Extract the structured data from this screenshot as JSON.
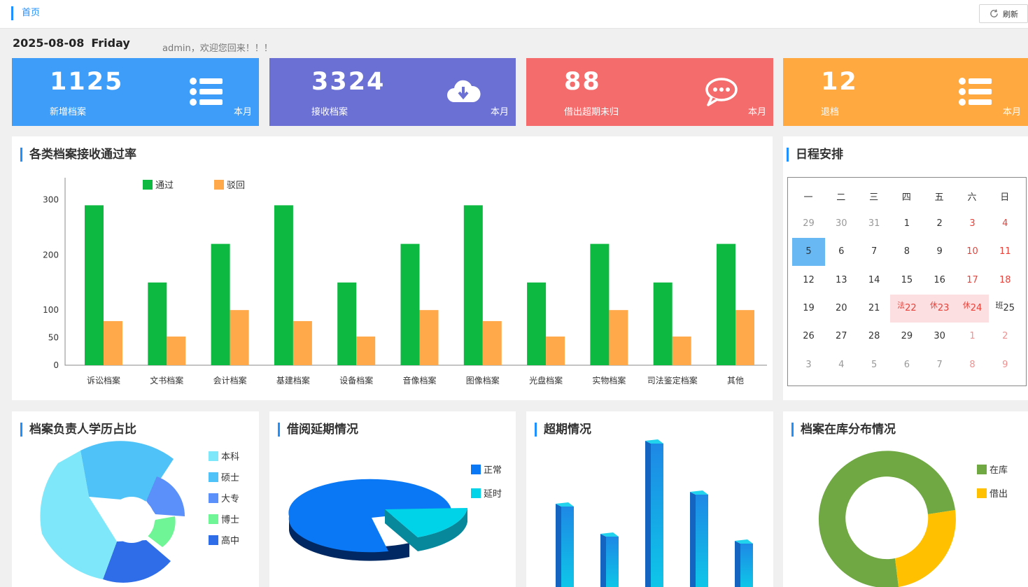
{
  "breadcrumb": {
    "home": "首页"
  },
  "toolbar": {
    "refresh_label": "刷新"
  },
  "header": {
    "date": "2025-08-08",
    "weekday": "Friday",
    "welcome": "admin，欢迎您回来！！！"
  },
  "stats": [
    {
      "value": "1125",
      "label": "新增档案",
      "period": "本月",
      "color": "#3d9df9",
      "icon": "list-icon"
    },
    {
      "value": "3324",
      "label": "接收档案",
      "period": "本月",
      "color": "#6b70d4",
      "icon": "cloud-download-icon"
    },
    {
      "value": "88",
      "label": "借出超期未归",
      "period": "本月",
      "color": "#f56c6c",
      "icon": "chat-icon"
    },
    {
      "value": "12",
      "label": "退档",
      "period": "本月",
      "color": "#ffa940",
      "icon": "list-icon"
    }
  ],
  "panels": {
    "pass_rate": "各类档案接收通过率",
    "schedule": "日程安排",
    "education": "档案负责人学历占比",
    "borrow_delay": "借阅延期情况",
    "overdue": "超期情况",
    "storage": "档案在库分布情况"
  },
  "calendar": {
    "weekdays": [
      "一",
      "二",
      "三",
      "四",
      "五",
      "六",
      "日"
    ],
    "rows": [
      [
        {
          "d": "29",
          "o": true
        },
        {
          "d": "30",
          "o": true
        },
        {
          "d": "31",
          "o": true
        },
        {
          "d": "1"
        },
        {
          "d": "2"
        },
        {
          "d": "3",
          "w": true
        },
        {
          "d": "4",
          "w": true
        }
      ],
      [
        {
          "d": "5",
          "today": true
        },
        {
          "d": "6"
        },
        {
          "d": "7"
        },
        {
          "d": "8"
        },
        {
          "d": "9"
        },
        {
          "d": "10",
          "w": true
        },
        {
          "d": "11",
          "w": true
        }
      ],
      [
        {
          "d": "12"
        },
        {
          "d": "13"
        },
        {
          "d": "14"
        },
        {
          "d": "15"
        },
        {
          "d": "16"
        },
        {
          "d": "17",
          "w": true
        },
        {
          "d": "18",
          "w": true
        }
      ],
      [
        {
          "d": "19"
        },
        {
          "d": "20"
        },
        {
          "d": "21"
        },
        {
          "d": "22",
          "h": true,
          "tag": "法"
        },
        {
          "d": "23",
          "h": true,
          "tag": "休"
        },
        {
          "d": "24",
          "h": true,
          "tag": "休"
        },
        {
          "d": "25",
          "tag": "班",
          "work": true
        }
      ],
      [
        {
          "d": "26"
        },
        {
          "d": "27"
        },
        {
          "d": "28"
        },
        {
          "d": "29"
        },
        {
          "d": "30"
        },
        {
          "d": "1",
          "o": true,
          "w": true
        },
        {
          "d": "2",
          "o": true,
          "w": true
        }
      ],
      [
        {
          "d": "3",
          "o": true
        },
        {
          "d": "4",
          "o": true
        },
        {
          "d": "5",
          "o": true
        },
        {
          "d": "6",
          "o": true
        },
        {
          "d": "7",
          "o": true
        },
        {
          "d": "8",
          "o": true,
          "w": true
        },
        {
          "d": "9",
          "o": true,
          "w": true
        }
      ]
    ]
  },
  "chart_data": [
    {
      "type": "bar",
      "categories": [
        "诉讼档案",
        "文书档案",
        "会计档案",
        "基建档案",
        "设备档案",
        "音像档案",
        "图像档案",
        "光盘档案",
        "实物档案",
        "司法鉴定档案",
        "其他"
      ],
      "series": [
        {
          "name": "通过",
          "color": "#0db941",
          "values": [
            290,
            150,
            220,
            290,
            150,
            220,
            290,
            150,
            220,
            150,
            220
          ]
        },
        {
          "name": "驳回",
          "color": "#ffa94a",
          "values": [
            80,
            52,
            100,
            80,
            52,
            100,
            80,
            52,
            100,
            52,
            100
          ]
        }
      ],
      "yticks": [
        "0",
        "50",
        "100",
        "200",
        "300"
      ],
      "ylim": [
        0,
        340
      ]
    },
    {
      "type": "pie",
      "style": "rose",
      "slices": [
        {
          "name": "本科",
          "color": "#7ee8fa"
        },
        {
          "name": "硕士",
          "color": "#4fc3f7"
        },
        {
          "name": "大专",
          "color": "#5b8ff9"
        },
        {
          "name": "博士",
          "color": "#6ff596"
        },
        {
          "name": "高中",
          "color": "#2f6de8"
        }
      ]
    },
    {
      "type": "pie",
      "style": "3d",
      "slices": [
        {
          "name": "正常",
          "value": 85,
          "color": "#0a78f5"
        },
        {
          "name": "延时",
          "value": 15,
          "color": "#00d2e8"
        }
      ]
    },
    {
      "type": "bar",
      "style": "3d",
      "values": [
        115,
        72,
        205,
        132,
        62
      ]
    },
    {
      "type": "pie",
      "style": "donut",
      "slices": [
        {
          "name": "在库",
          "value": 73,
          "color": "#70a844"
        },
        {
          "name": "借出",
          "value": 27,
          "color": "#ffc000"
        }
      ]
    }
  ]
}
